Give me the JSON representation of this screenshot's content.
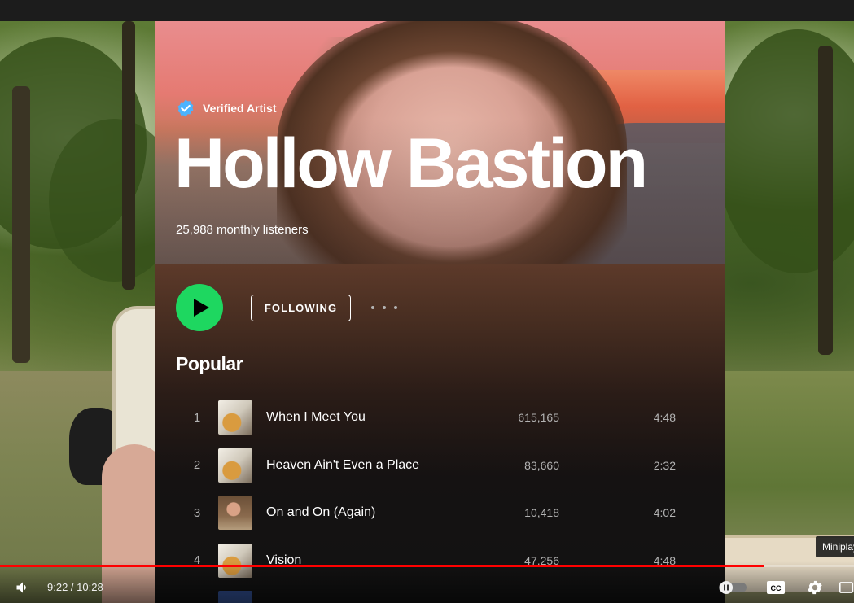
{
  "artist": {
    "verified_label": "Verified Artist",
    "name": "Hollow Bastion",
    "monthly_listeners": "25,988 monthly listeners"
  },
  "actions": {
    "follow_label": "FOLLOWING",
    "play_icon": "play-icon",
    "more_icon": "more-options-icon"
  },
  "popular": {
    "title": "Popular",
    "tracks": [
      {
        "number": "1",
        "title": "When I Meet You",
        "plays": "615,165",
        "duration": "4:48",
        "art": "guitar"
      },
      {
        "number": "2",
        "title": "Heaven Ain't Even a Place",
        "plays": "83,660",
        "duration": "2:32",
        "art": "guitar"
      },
      {
        "number": "3",
        "title": "On and On (Again)",
        "plays": "10,418",
        "duration": "4:02",
        "art": "sofa"
      },
      {
        "number": "4",
        "title": "Vision",
        "plays": "47,256",
        "duration": "4:48",
        "art": "guitar"
      }
    ]
  },
  "player": {
    "time": "9:22 / 10:28",
    "progress": 0.895,
    "tooltip": "Miniplayer",
    "icons": [
      "volume-icon",
      "autoplay-toggle-icon",
      "captions-icon",
      "settings-icon",
      "miniplayer-icon"
    ]
  },
  "colors": {
    "accent_green": "#1ed760",
    "progress_red": "#ff0000",
    "background": "#121212"
  }
}
